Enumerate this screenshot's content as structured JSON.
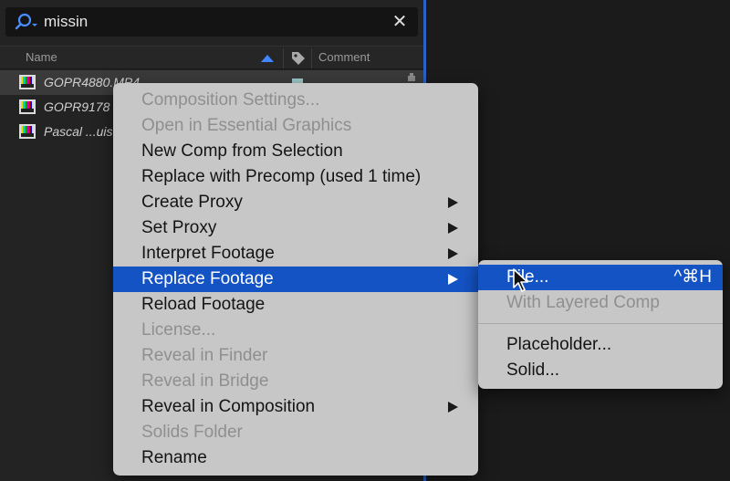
{
  "search": {
    "value": "missin"
  },
  "columns": {
    "name": "Name",
    "comment": "Comment"
  },
  "rows": [
    {
      "name": "GOPR4880.MP4"
    },
    {
      "name": "GOPR9178"
    },
    {
      "name": "Pascal ...uis"
    }
  ],
  "context_menu": {
    "items": [
      {
        "label": "Composition Settings..."
      },
      {
        "label": "Open in Essential Graphics"
      },
      {
        "label": "New Comp from Selection"
      },
      {
        "label": "Replace with Precomp (used 1 time)"
      },
      {
        "label": "Create Proxy"
      },
      {
        "label": "Set Proxy"
      },
      {
        "label": "Interpret Footage"
      },
      {
        "label": "Replace Footage"
      },
      {
        "label": "Reload Footage"
      },
      {
        "label": "License..."
      },
      {
        "label": "Reveal in Finder"
      },
      {
        "label": "Reveal in Bridge"
      },
      {
        "label": "Reveal in Composition"
      },
      {
        "label": "Solids Folder"
      },
      {
        "label": "Rename"
      }
    ]
  },
  "submenu": {
    "items": [
      {
        "label": "File...",
        "shortcut": "^⌘H"
      },
      {
        "label": "With Layered Comp"
      },
      {
        "label": "Placeholder..."
      },
      {
        "label": "Solid..."
      }
    ]
  },
  "colors": {
    "highlight": "#1453c4",
    "menu_bg": "#c7c7c7",
    "panel_accent": "#2a63c4"
  }
}
